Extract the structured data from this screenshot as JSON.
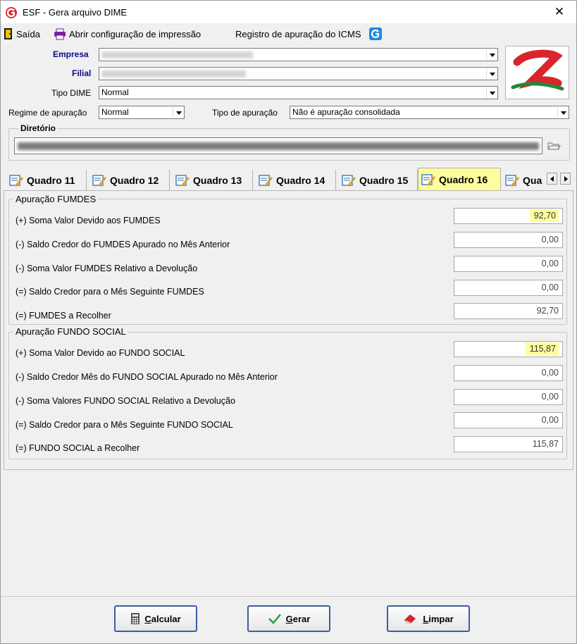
{
  "window": {
    "title": "ESF - Gera arquivo DIME",
    "close_glyph": "✕"
  },
  "toolbar": {
    "exit_label": "Saída",
    "print_config_label": "Abrir configuração de impressão",
    "icms_label": "Registro de apuração do ICMS"
  },
  "form": {
    "empresa_label": "Empresa",
    "filial_label": "Filial",
    "tipo_dime_label": "Tipo DIME",
    "tipo_dime_value": "Normal",
    "regime_label": "Regime de apuração",
    "regime_value": "Normal",
    "tipo_apuracao_label": "Tipo de apuração",
    "tipo_apuracao_value": "Não é apuração consolidada"
  },
  "directory": {
    "title": "Diretório"
  },
  "tabs": [
    {
      "label": "Quadro 11"
    },
    {
      "label": "Quadro 12"
    },
    {
      "label": "Quadro 13"
    },
    {
      "label": "Quadro 14"
    },
    {
      "label": "Quadro 15"
    },
    {
      "label": "Quadro 16",
      "active": true
    },
    {
      "label": "Qua"
    }
  ],
  "fumdes": {
    "title": "Apuração FUMDES",
    "rows": [
      {
        "label": "(+) Soma Valor Devido aos FUMDES",
        "value": "92,70",
        "highlight": true
      },
      {
        "label": "(-) Saldo Credor do FUMDES Apurado no Mês Anterior",
        "value": "0,00"
      },
      {
        "label": "(-) Soma Valor FUMDES Relativo a Devolução",
        "value": "0,00"
      },
      {
        "label": "(=) Saldo Credor para o Mês Seguinte FUMDES",
        "value": "0,00"
      },
      {
        "label": "(=) FUMDES a Recolher",
        "value": "92,70"
      }
    ]
  },
  "fundo_social": {
    "title": "Apuração FUNDO SOCIAL",
    "rows": [
      {
        "label": "(+) Soma Valor Devido ao FUNDO SOCIAL",
        "value": "115,87",
        "highlight": true
      },
      {
        "label": "(-) Saldo Credor Mês do FUNDO SOCIAL Apurado no Mês Anterior",
        "value": "0,00"
      },
      {
        "label": "(-) Soma Valores FUNDO SOCIAL Relativo a Devolução",
        "value": "0,00"
      },
      {
        "label": "(=) Saldo Credor para o Mês Seguinte FUNDO SOCIAL",
        "value": "0,00"
      },
      {
        "label": "(=) FUNDO SOCIAL a Recolher",
        "value": "115,87"
      }
    ]
  },
  "buttons": {
    "calcular_first": "C",
    "calcular_rest": "alcular",
    "gerar_first": "G",
    "gerar_rest": "erar",
    "limpar_first": "L",
    "limpar_rest": "impar"
  },
  "colors": {
    "highlight": "#fdfd9e",
    "label_blue": "#0a0a8a",
    "logo_red": "#d8262a",
    "logo_green": "#1f8a3a"
  }
}
